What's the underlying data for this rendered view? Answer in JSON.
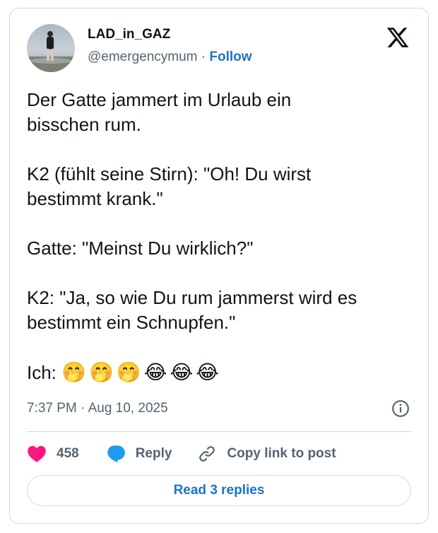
{
  "author": {
    "name": "LAD_in_GAZ",
    "handle": "@emergencymum",
    "separator": "·",
    "follow_label": "Follow"
  },
  "brand_icon": "x-logo-icon",
  "tweet": {
    "paragraphs": [
      "Der Gatte jammert im Urlaub ein\nbisschen rum.",
      "K2 (fühlt seine Stirn): \"Oh! Du wirst\nbestimmt krank.\"",
      "Gatte: \"Meinst Du wirklich?\"",
      "K2: \"Ja, so wie Du rum jammerst wird es\nbestimmt ein Schnupfen.\""
    ],
    "last_line_prefix": "Ich: ",
    "emojis": [
      "🤭",
      "🤭",
      "🤭",
      "😂",
      "😂",
      "😂"
    ]
  },
  "meta": {
    "timestamp": "7:37 PM · Aug 10, 2025",
    "info_icon": "info-icon"
  },
  "actions": {
    "like_count": "458",
    "reply_label": "Reply",
    "copy_label": "Copy link to post"
  },
  "replies_button": "Read 3 replies",
  "colors": {
    "like": "#f91880",
    "reply": "#1d9bf0",
    "link": "#1d74c5",
    "muted": "#536471",
    "border": "#cfd9de"
  }
}
